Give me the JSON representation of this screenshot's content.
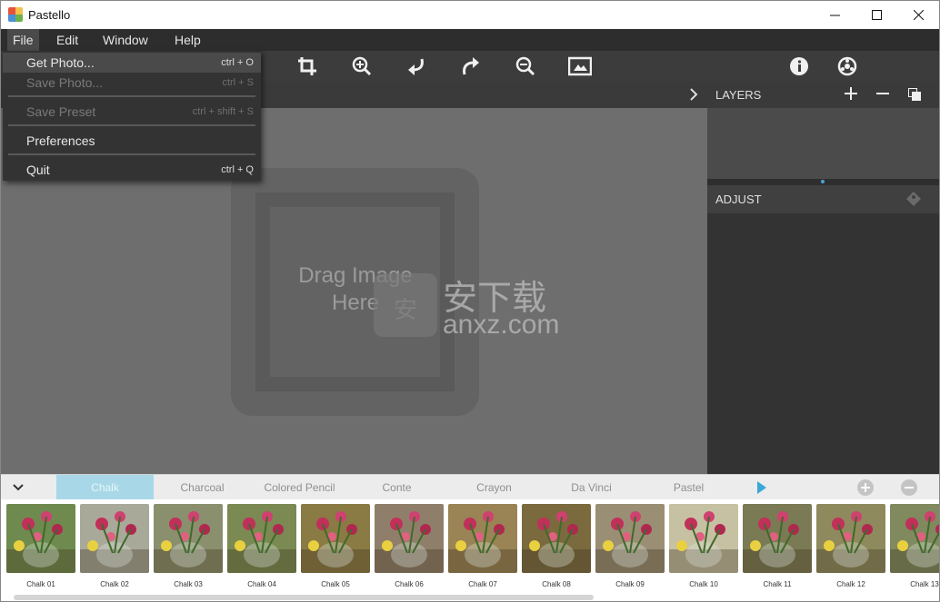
{
  "window": {
    "title": "Pastello",
    "minimize_icon": "minimize-icon",
    "maximize_icon": "maximize-icon",
    "close_icon": "close-icon"
  },
  "menubar": {
    "items": [
      "File",
      "Edit",
      "Window",
      "Help"
    ],
    "active": "File"
  },
  "file_menu": {
    "items": [
      {
        "label": "Get Photo...",
        "shortcut": "ctrl + O",
        "enabled": true
      },
      {
        "label": "Save Photo...",
        "shortcut": "ctrl + S",
        "enabled": false
      },
      {
        "label": "Save Preset",
        "shortcut": "ctrl + shift + S",
        "enabled": false
      },
      {
        "label": "Preferences",
        "shortcut": "",
        "enabled": true
      },
      {
        "label": "Quit",
        "shortcut": "ctrl + Q",
        "enabled": true
      }
    ]
  },
  "toolbar": {
    "icons": [
      "crop-icon",
      "zoom-in-icon",
      "undo-icon",
      "redo-icon",
      "zoom-out-icon",
      "fit-image-icon",
      "info-icon",
      "settings-icon"
    ]
  },
  "canvas": {
    "drop_line1": "Drag Image",
    "drop_line2": "Here"
  },
  "layers": {
    "title": "LAYERS"
  },
  "adjust": {
    "title": "ADJUST"
  },
  "watermark": {
    "text_cn": "安下载",
    "text_en": "anxz.com",
    "badge": "安"
  },
  "filter_tabs": {
    "items": [
      "Chalk",
      "Charcoal",
      "Colored Pencil",
      "Conte",
      "Crayon",
      "Da Vinci",
      "Pastel"
    ],
    "active": "Chalk"
  },
  "presets": {
    "labels": [
      "Chalk 01",
      "Chalk 02",
      "Chalk 03",
      "Chalk 04",
      "Chalk 05",
      "Chalk 06",
      "Chalk 07",
      "Chalk 08",
      "Chalk 09",
      "Chalk 10",
      "Chalk 11",
      "Chalk 12",
      "Chalk 13"
    ],
    "tints": [
      "#6f8a4e",
      "#a9a99a",
      "#8a8f6e",
      "#7a8a52",
      "#8a7a44",
      "#8f7f6a",
      "#9a8355",
      "#7a6a3e",
      "#9a8f74",
      "#c7c1a4",
      "#7a7a54",
      "#8f8a5e",
      "#808a5e"
    ]
  },
  "colors": {
    "accent": "#4aa3d8",
    "active_tab": "#a8d8e8"
  }
}
